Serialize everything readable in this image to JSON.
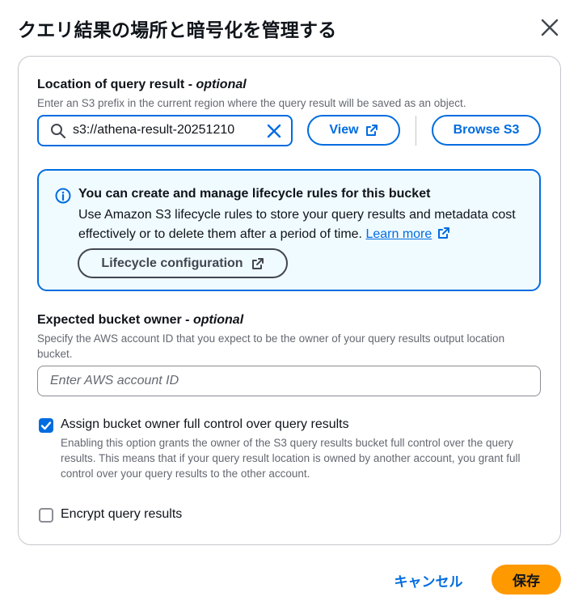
{
  "dialog": {
    "title": "クエリ結果の場所と暗号化を管理する"
  },
  "location": {
    "label": "Location of query result - ",
    "optional": "optional",
    "description": "Enter an S3 prefix in the current region where the query result will be saved as an object.",
    "value": "s3://athena-result-20251210",
    "view_label": "View",
    "browse_label": "Browse S3"
  },
  "info": {
    "title": "You can create and manage lifecycle rules for this bucket",
    "body": "Use Amazon S3 lifecycle rules to store your query results and metadata cost effectively or to delete them after a period of time. ",
    "learn_more": "Learn more",
    "lifecycle_label": "Lifecycle configuration"
  },
  "owner": {
    "label": "Expected bucket owner - ",
    "optional": "optional",
    "description": "Specify the AWS account ID that you expect to be the owner of your query results output location bucket.",
    "placeholder": "Enter AWS account ID"
  },
  "assign_control": {
    "label": "Assign bucket owner full control over query results",
    "description": "Enabling this option grants the owner of the S3 query results bucket full control over the query results. This means that if your query result location is owned by another account, you grant full control over your query results to the other account.",
    "checked": true
  },
  "encrypt": {
    "label": "Encrypt query results",
    "checked": false
  },
  "footer": {
    "cancel_label": "キャンセル",
    "save_label": "保存"
  },
  "colors": {
    "accent": "#006ce0",
    "primary_button": "#ff9900",
    "info_background": "#f0fbff"
  },
  "icons": [
    "close-icon",
    "search-icon",
    "clear-icon",
    "external-link-icon",
    "info-icon",
    "checkmark-icon"
  ]
}
